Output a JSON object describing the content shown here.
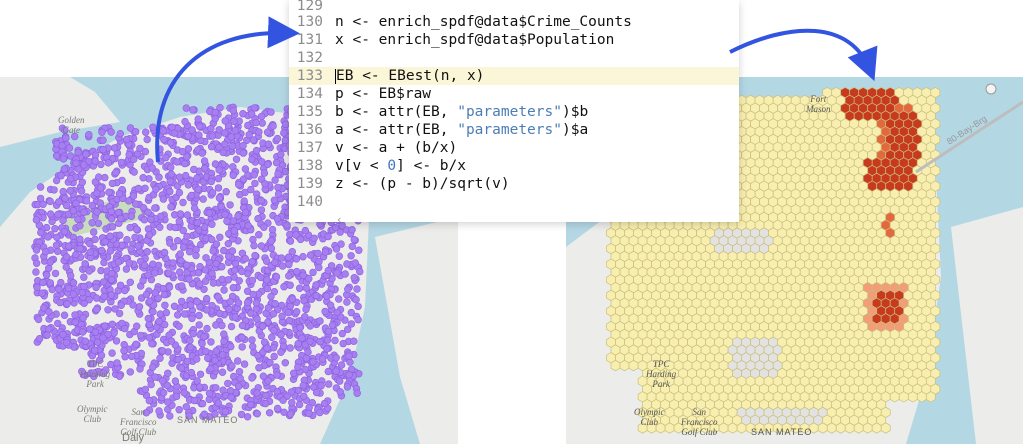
{
  "code_editor": {
    "lines": [
      {
        "num": "129",
        "segments": []
      },
      {
        "num": "130",
        "segments": [
          [
            "code",
            "n <- enrich_spdf@data$Crime_Counts"
          ]
        ]
      },
      {
        "num": "131",
        "segments": [
          [
            "code",
            "x <- enrich_spdf@data$Population"
          ]
        ]
      },
      {
        "num": "132",
        "segments": []
      },
      {
        "num": "133",
        "current": true,
        "segments": [
          [
            "code",
            "EB <- EBest(n, x)"
          ]
        ]
      },
      {
        "num": "134",
        "segments": [
          [
            "code",
            "p <- EB$raw"
          ]
        ]
      },
      {
        "num": "135",
        "segments": [
          [
            "code",
            "b <- attr(EB, "
          ],
          [
            "str",
            "\"parameters\""
          ],
          [
            "code",
            ")$b"
          ]
        ]
      },
      {
        "num": "136",
        "segments": [
          [
            "code",
            "a <- attr(EB, "
          ],
          [
            "str",
            "\"parameters\""
          ],
          [
            "code",
            ")$a"
          ]
        ]
      },
      {
        "num": "137",
        "segments": [
          [
            "code",
            "v <- a + (b/x)"
          ]
        ]
      },
      {
        "num": "138",
        "segments": [
          [
            "code",
            "v[v < "
          ],
          [
            "num",
            "0"
          ],
          [
            "code",
            "] <- b/x"
          ]
        ]
      },
      {
        "num": "139",
        "segments": [
          [
            "code",
            "z <- (p - b)/sqrt(v)"
          ]
        ]
      },
      {
        "num": "140",
        "segments": []
      }
    ],
    "scroll_arrow": "‹"
  },
  "left_map": {
    "labels": {
      "golden_gate": "Golden\nGate",
      "tpc_harding_park": "TPC\nHarding\nPark",
      "olympic_club": "Olympic\nClub",
      "san_francisco_golf_club": "San\nFrancisco\nGolf Club",
      "san_mateo": "SAN MATEO",
      "daly": "Daly"
    },
    "point_color": "#a77ff0"
  },
  "right_map": {
    "labels": {
      "fort_mason": "Fort\nMason",
      "bay_bridge": "80-Bay-Brg",
      "tpc_harding_park": "TPC\nHarding\nPark",
      "olympic_club": "Olympic\nClub",
      "san_francisco_golf_club": "San\nFrancisco\nGolf Club",
      "san_mateo": "SAN MATEO"
    },
    "hex_colors": {
      "base": "#f8eeb0",
      "border": "#c9bf7a",
      "hot_dark": "#c83a1e",
      "hot_mid": "#e4683e",
      "hot_light": "#f29c78",
      "cold_gray": "#e2e2e2"
    }
  },
  "colors": {
    "water": "#b4d7e4",
    "land": "#ececea",
    "park": "#c8ddbd",
    "arrow": "#3354e0"
  }
}
